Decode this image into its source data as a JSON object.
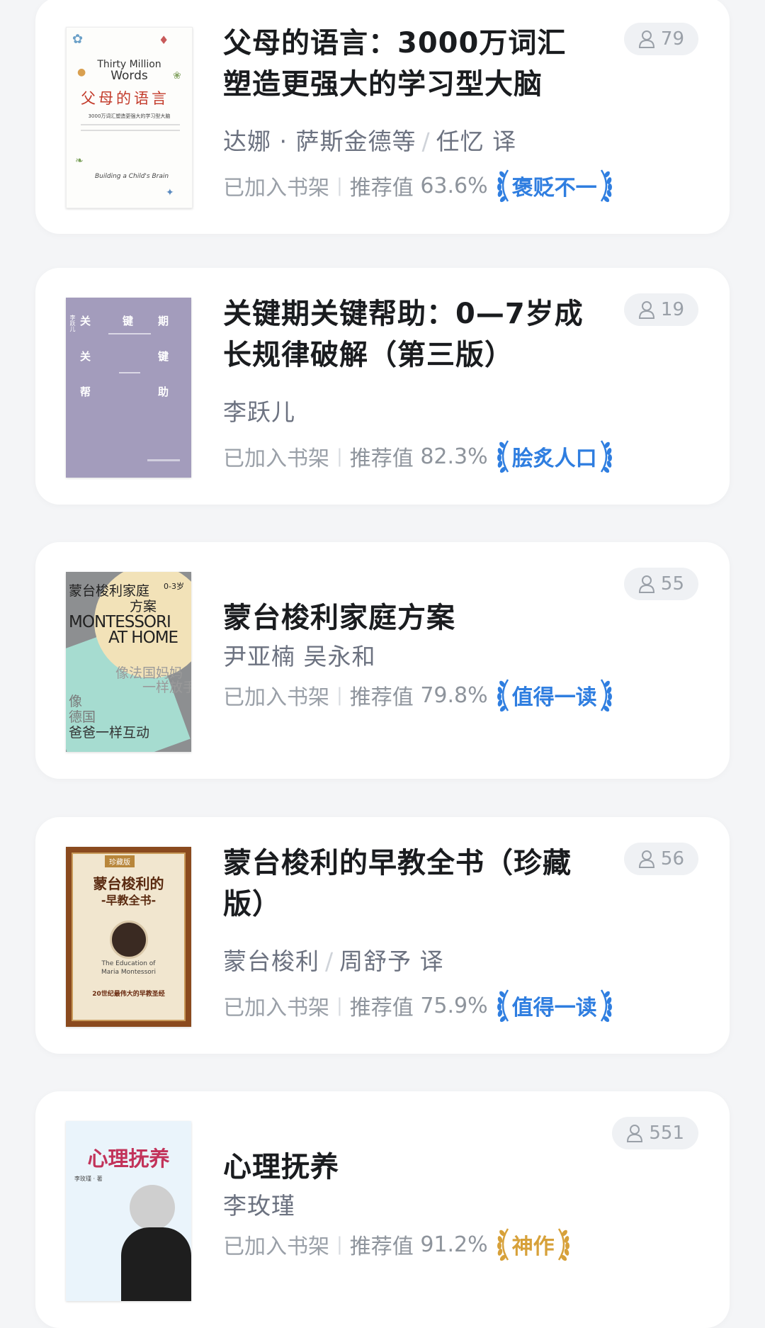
{
  "books": [
    {
      "title": "父母的语言：3000万词汇塑造更强大的学习型大脑",
      "author": "达娜 · 萨斯金德等",
      "translator": "任忆 译",
      "shelf_status": "已加入书架",
      "rec_label": "推荐值",
      "rec_value": "63.6%",
      "badge": "褒贬不一",
      "readers": "79",
      "cover": {
        "line1": "Thirty Million",
        "line2": "Words",
        "chars": [
          "父",
          "母",
          "的",
          "语",
          "言"
        ],
        "subtitle": "3000万词汇塑造更强大的学习型大脑",
        "footer": "Building a Child's Brain"
      }
    },
    {
      "title": "关键期关键帮助：0—7岁成长规律破解（第三版）",
      "author": "李跃儿",
      "shelf_status": "已加入书架",
      "rec_label": "推荐值",
      "rec_value": "82.3%",
      "badge": "脍炙人口",
      "readers": "19",
      "cover": {
        "c1": "关",
        "c2": "键",
        "c3": "期",
        "c4": "关",
        "c5": "键",
        "c6": "帮",
        "c7": "助",
        "side": "李跃儿"
      }
    },
    {
      "title": "蒙台梭利家庭方案",
      "author": "尹亚楠 吴永和",
      "shelf_status": "已加入书架",
      "rec_label": "推荐值",
      "rec_value": "79.8%",
      "badge": "值得一读",
      "readers": "55",
      "cover": {
        "l1": "蒙台梭利家庭",
        "l2": "方案",
        "age": "0-3岁",
        "en1": "MONTESSORI",
        "en2": "AT HOME",
        "mom1": "像法国妈妈",
        "mom2": "一样放手",
        "dad1": "像",
        "dad2": "德国",
        "dad3": "爸爸一样互动"
      }
    },
    {
      "title": "蒙台梭利的早教全书（珍藏版）",
      "author": "蒙台梭利",
      "translator": "周舒予 译",
      "shelf_status": "已加入书架",
      "rec_label": "推荐值",
      "rec_value": "75.9%",
      "badge": "值得一读",
      "readers": "56",
      "cover": {
        "edition": "珍藏版",
        "t1": "蒙台梭利的",
        "t2": "-早教全书-",
        "en1": "The Education of",
        "en2": "Maria Montessori",
        "tag": "20世纪最伟大的早教圣经"
      }
    },
    {
      "title": "心理抚养",
      "author": "李玫瑾",
      "shelf_status": "已加入书架",
      "rec_label": "推荐值",
      "rec_value": "91.2%",
      "badge": "神作",
      "readers": "551",
      "cover": {
        "t": "心理抚养",
        "a": "李玫瑾 · 著"
      }
    }
  ],
  "colors": {
    "badge_blue": "#2f7ee0",
    "badge_gold": "#d7a13a"
  },
  "icons": {
    "reader": "person-outline-icon",
    "laurel": "laurel-wreath-icon"
  }
}
